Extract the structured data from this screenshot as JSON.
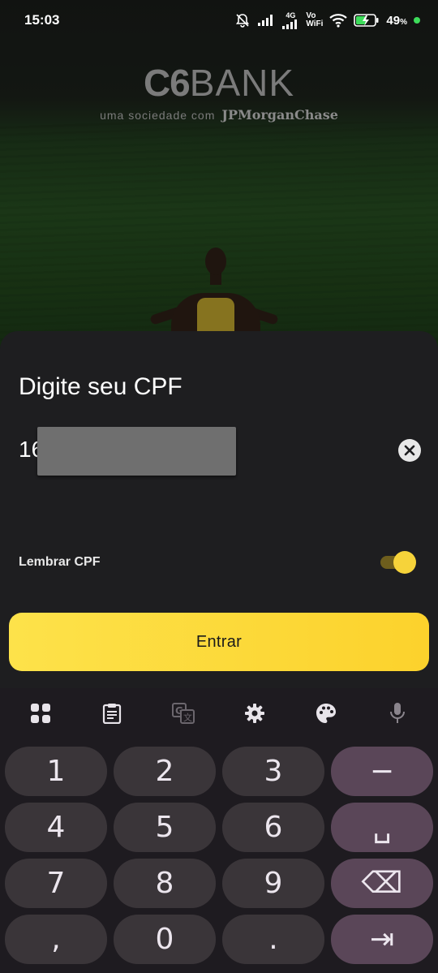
{
  "status_bar": {
    "time": "15:03",
    "network_label": "4G",
    "volte_label": "Vo\nWiFi",
    "battery": "49",
    "battery_unit": "%"
  },
  "brand": {
    "logo_c6": "C6",
    "logo_bank": "BANK",
    "tagline": "uma sociedade com",
    "partner": "JPMorganChase"
  },
  "login": {
    "title": "Digite seu CPF",
    "cpf_value": "16",
    "remember_label": "Lembrar CPF",
    "remember_enabled": true,
    "enter_label": "Entrar",
    "accent_color": "#fcd22c"
  },
  "keyboard": {
    "toolbar": [
      "apps-icon",
      "clipboard-icon",
      "translate-icon",
      "settings-icon",
      "palette-icon",
      "mic-icon"
    ],
    "keys": [
      {
        "label": "1",
        "name": "key-1"
      },
      {
        "label": "2",
        "name": "key-2"
      },
      {
        "label": "3",
        "name": "key-3"
      },
      {
        "label": "−",
        "name": "key-minus"
      },
      {
        "label": "4",
        "name": "key-4"
      },
      {
        "label": "5",
        "name": "key-5"
      },
      {
        "label": "6",
        "name": "key-6"
      },
      {
        "label": "␣",
        "name": "key-space"
      },
      {
        "label": "7",
        "name": "key-7"
      },
      {
        "label": "8",
        "name": "key-8"
      },
      {
        "label": "9",
        "name": "key-9"
      },
      {
        "label": "⌫",
        "name": "key-backspace"
      },
      {
        "label": ",",
        "name": "key-comma"
      },
      {
        "label": "0",
        "name": "key-0"
      },
      {
        "label": ".",
        "name": "key-period"
      },
      {
        "label": "⇥",
        "name": "key-next"
      }
    ]
  }
}
